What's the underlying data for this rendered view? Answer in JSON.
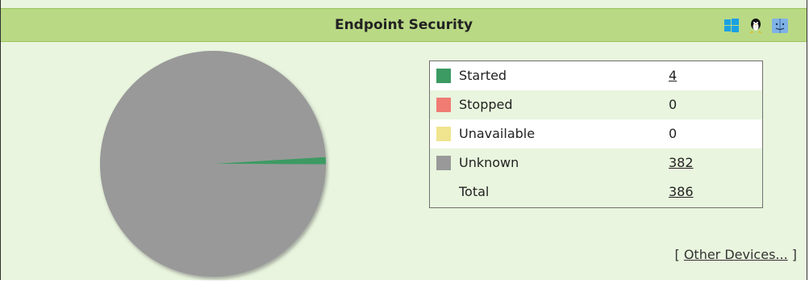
{
  "header": {
    "title": "Endpoint Security",
    "os_icons": [
      "windows-icon",
      "linux-icon",
      "mac-icon"
    ]
  },
  "legend": {
    "rows": [
      {
        "label": "Started",
        "value": "4",
        "color": "#3c9a63",
        "link": true
      },
      {
        "label": "Stopped",
        "value": "0",
        "color": "#f07c74",
        "link": false
      },
      {
        "label": "Unavailable",
        "value": "0",
        "color": "#f0e48e",
        "link": false
      },
      {
        "label": "Unknown",
        "value": "382",
        "color": "#999999",
        "link": true
      }
    ],
    "total": {
      "label": "Total",
      "value": "386",
      "link": true
    }
  },
  "other_devices": {
    "open": "[",
    "link": "Other Devices...",
    "close": "]"
  },
  "chart_data": {
    "type": "pie",
    "slices": [
      {
        "label": "Started",
        "value": 4,
        "color": "#3c9a63"
      },
      {
        "label": "Stopped",
        "value": 0,
        "color": "#f07c74"
      },
      {
        "label": "Unavailable",
        "value": 0,
        "color": "#f0e48e"
      },
      {
        "label": "Unknown",
        "value": 382,
        "color": "#999999"
      }
    ],
    "total": 386
  }
}
